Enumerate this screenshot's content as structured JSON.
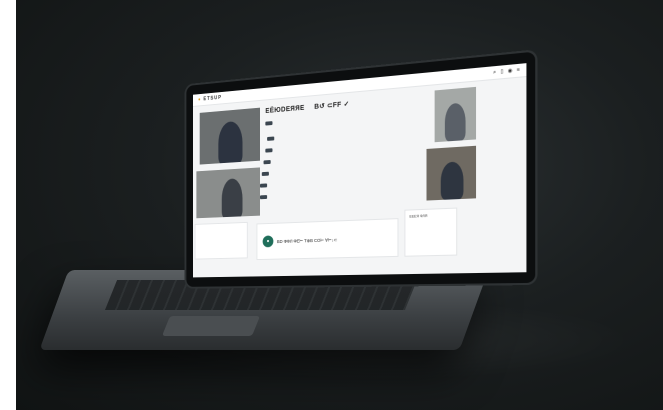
{
  "screen": {
    "brand": "ETSUP",
    "headline_a": "ЕЁЮDEЯЯЕ",
    "headline_b": "B↺ ⊂FF ✓",
    "bottom_label": "BD  ФФЛ ФЕ⊢  T⊕B  CO⊢  ∀⊢↓⊂",
    "side_label": "EEEЯ ФЛЯ"
  }
}
